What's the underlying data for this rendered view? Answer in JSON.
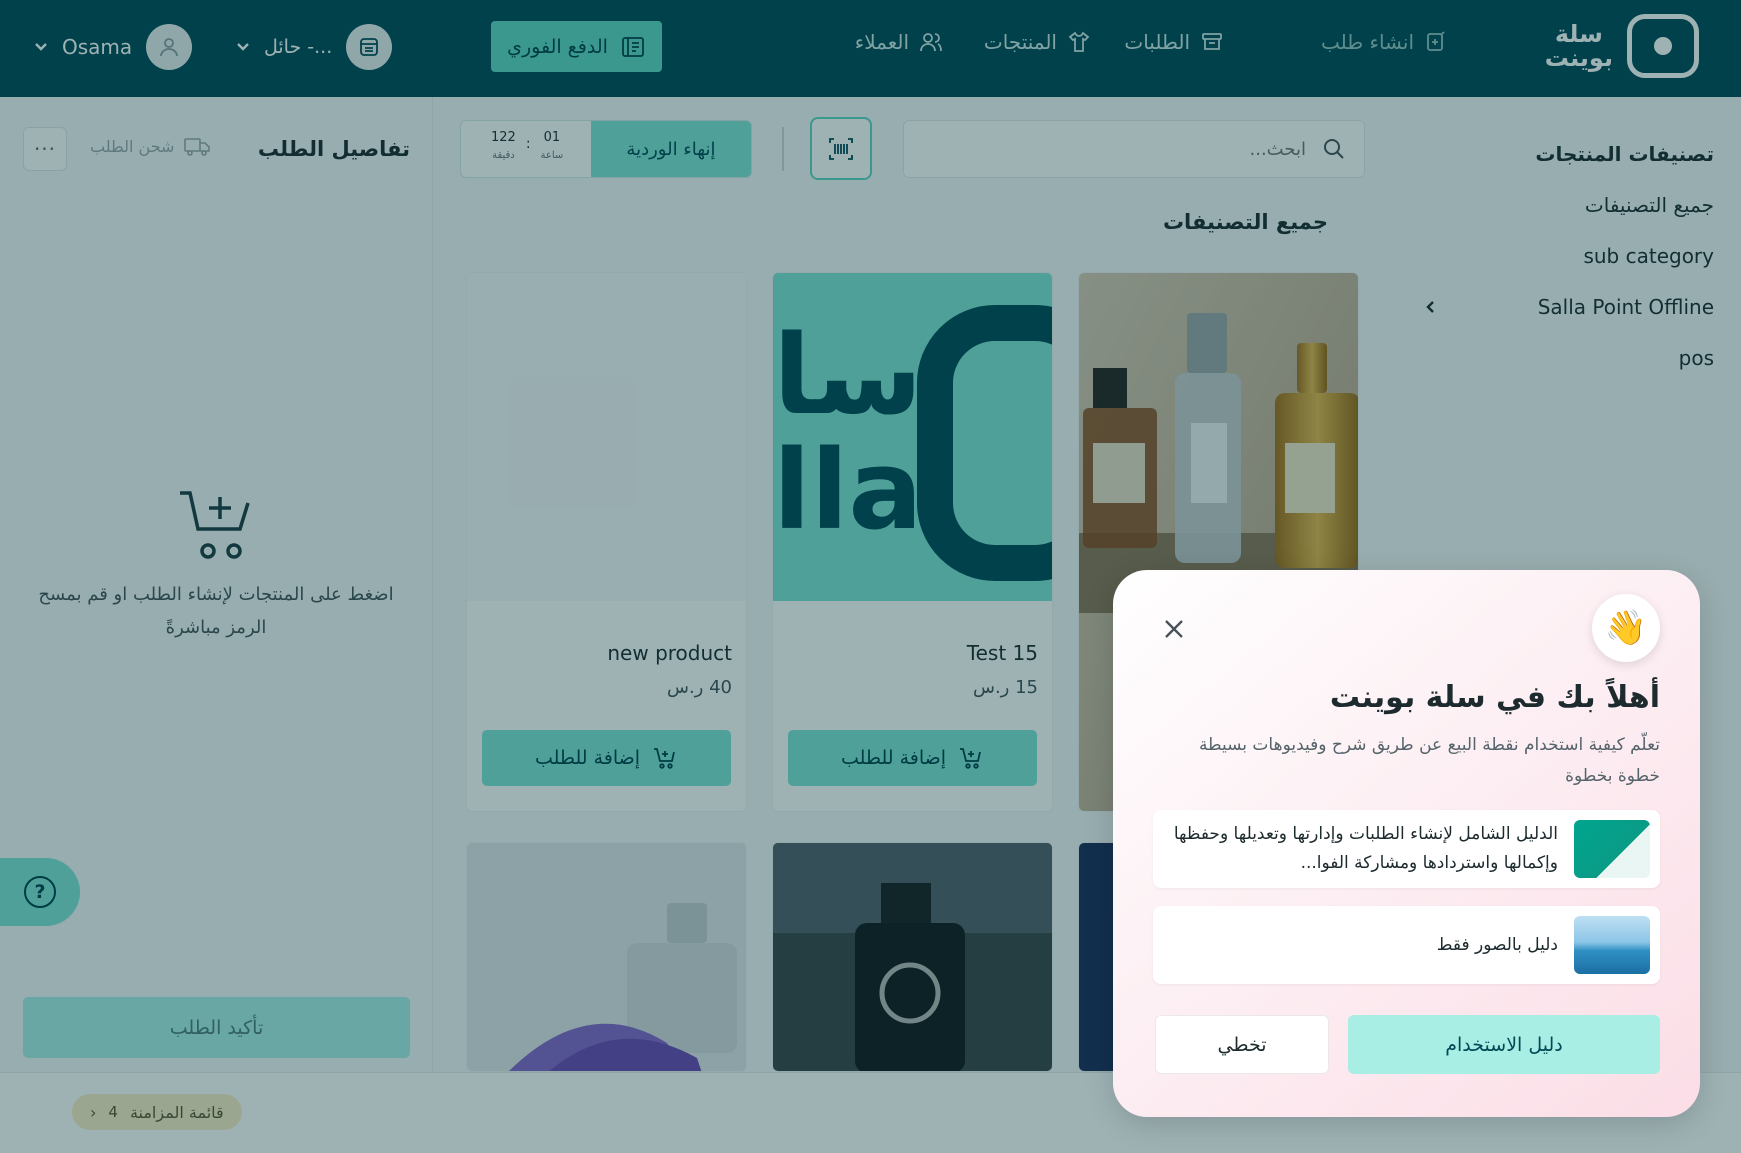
{
  "header": {
    "logo_text_line1": "سلة",
    "logo_text_line2": "بوينت",
    "nav": [
      {
        "label": "انشاء طلب",
        "icon": "create-order-icon"
      },
      {
        "label": "الطلبات",
        "icon": "orders-box-icon"
      },
      {
        "label": "المنتجات",
        "icon": "shirt-icon"
      },
      {
        "label": "العملاء",
        "icon": "users-icon"
      }
    ],
    "instant_pay_label": "الدفع الفوري",
    "branch_label": "حائل -...",
    "user_name": "Osama"
  },
  "categories": {
    "title": "تصنيفات المنتجات",
    "items": [
      "جميع التصنيفات",
      "sub category",
      "Salla Point Offline",
      "pos"
    ]
  },
  "toolbar": {
    "search_placeholder": "ابحث...",
    "end_shift_label": "إنهاء الوردية",
    "timer_hours": "01",
    "timer_hours_unit": "ساعة",
    "timer_minutes": "122",
    "timer_minutes_unit": "دقيقة",
    "timer_sep": ":"
  },
  "section_title": "جميع التصنيفات",
  "products": [
    {
      "name": "new product",
      "price": "40 ر.س",
      "add_label": "إضافة للطلب"
    },
    {
      "name": "Test 15",
      "price": "15 ر.س",
      "add_label": "إضافة للطلب"
    }
  ],
  "order": {
    "title": "تفاصيل الطلب",
    "ship_label": "شحن الطلب",
    "more_label": "···",
    "empty_message": "اضغط على المنتجات لإنشاء الطلب او قم بمسح الرمز مباشرةً",
    "confirm_label": "تأكيد الطلب"
  },
  "footer": {
    "sync_label": "قائمة المزامنة",
    "sync_count": "4"
  },
  "modal": {
    "title": "أهلاً بك في سلة بوينت",
    "description": "تعلّم كيفية استخدام نقطة البيع عن طريق شرح وفيديوهات بسيطة خطوة بخطوة",
    "guides": [
      {
        "text": "الدليل الشامل لإنشاء الطلبات وإدارتها وتعديلها وحفظها وإكمالها واستردادها ومشاركة الفوا...",
        "icon": "guide-thumbnail-green"
      },
      {
        "text": "دليل بالصور فقط",
        "icon": "guide-thumbnail-sea"
      }
    ],
    "primary_label": "دليل الاستخدام",
    "skip_label": "تخطي"
  },
  "colors": {
    "brand_dark": "#004956",
    "brand_accent": "#5fd6c4",
    "brand_light": "#80e3d4"
  }
}
